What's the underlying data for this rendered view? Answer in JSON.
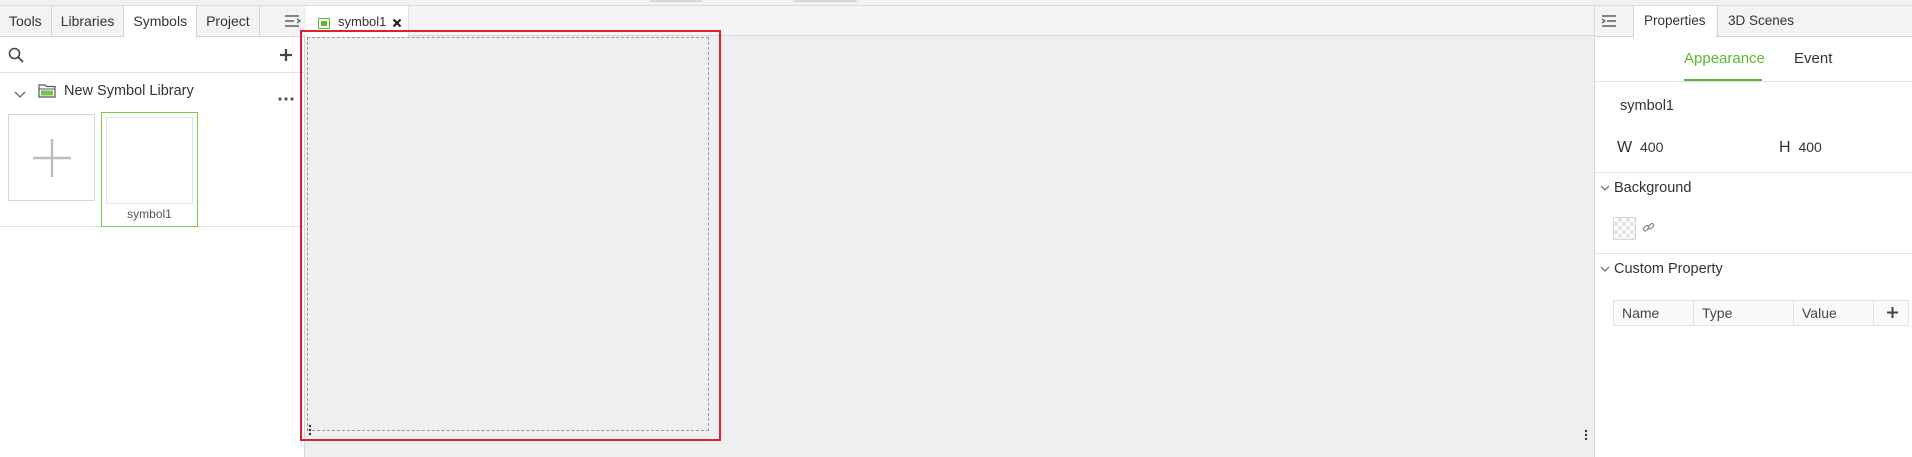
{
  "left_panel": {
    "tabs": [
      {
        "label": "Tools"
      },
      {
        "label": "Libraries"
      },
      {
        "label": "Symbols"
      },
      {
        "label": "Project"
      }
    ],
    "active_tab": "Symbols",
    "search": {
      "placeholder": "",
      "value": ""
    },
    "library": {
      "name": "New Symbol Library"
    },
    "symbols": [
      {
        "label": "symbol1"
      }
    ]
  },
  "document": {
    "tab_label": "symbol1"
  },
  "right_panel": {
    "tabs": [
      {
        "label": "Properties"
      },
      {
        "label": "3D Scenes"
      }
    ],
    "active_tab": "Properties",
    "subtabs": [
      {
        "label": "Appearance"
      },
      {
        "label": "Event"
      }
    ],
    "active_subtab": "Appearance",
    "symbol_name": "symbol1",
    "width": {
      "key": "W",
      "value": "400"
    },
    "height": {
      "key": "H",
      "value": "400"
    },
    "background": {
      "title": "Background"
    },
    "custom_property": {
      "title": "Custom Property",
      "columns": [
        "Name",
        "Type",
        "Value"
      ]
    }
  },
  "colors": {
    "accent": "#5cb82c",
    "selection_border": "#e0202a"
  }
}
